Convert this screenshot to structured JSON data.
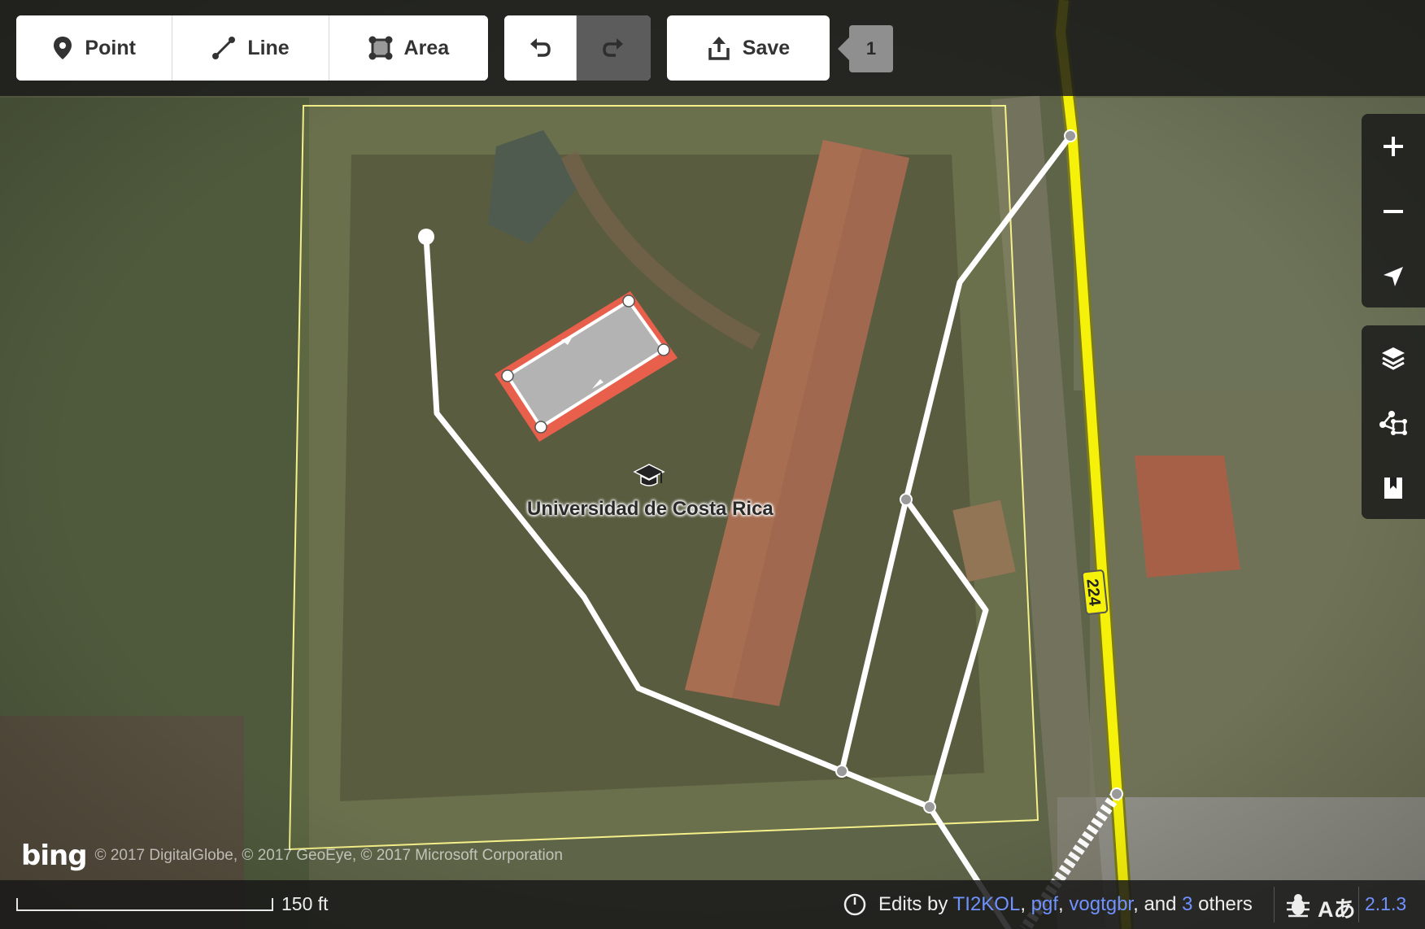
{
  "toolbar": {
    "point_label": "Point",
    "line_label": "Line",
    "area_label": "Area",
    "save_label": "Save",
    "edit_count": "1"
  },
  "map": {
    "poi_label": "Universidad de Costa Rica",
    "poi_icon": "graduation-cap-icon",
    "road_ref": "224",
    "road_color": "#f5f10a",
    "selected_area_color": "#e8604c",
    "imagery_attribution_logo": "bing",
    "imagery_attribution": "© 2017 DigitalGlobe, © 2017 GeoEye, © 2017 Microsoft Corporation"
  },
  "map_controls": {
    "zoom_in": "plus-icon",
    "zoom_out": "minus-icon",
    "geolocate": "location-arrow-icon",
    "background": "layers-icon",
    "map_data": "map-data-icon",
    "issues": "bookmark-icon"
  },
  "footer": {
    "scale_text": "150 ft",
    "edits_prefix": "Edits by ",
    "contributors": [
      "TI2KOL",
      "pgf",
      "vogtgbr"
    ],
    "and_text": ", and ",
    "others_count": "3",
    "others_text": " others",
    "version": "2.1.3"
  }
}
